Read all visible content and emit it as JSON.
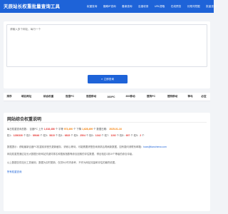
{
  "header": {
    "brand": "天辰站长权重批量查询工具",
    "nav": [
      "权重查询",
      "蜘蛛IP查询",
      "备案查询",
      "百度收录",
      "URL提取",
      "在线预览",
      "长尾词挖掘",
      "批量查询"
    ]
  },
  "search": {
    "placeholder": "请输入多个网址，每行一个",
    "button_label": "立即查询",
    "button_icon": "search-icon"
  },
  "table": {
    "headers": [
      "排序",
      "域名网址",
      "综合权重",
      "百度PC",
      "百度移动",
      "360PC",
      "360移动",
      "搜狗PC",
      "搜狗移动",
      "神马",
      "必应"
    ]
  },
  "info": {
    "title": "网站综合权重说明",
    "line1": {
      "label": "每日权重查询总数：",
      "baidu_pc_label": "百度PC 上升",
      "baidu_pc_value": "1,618,486",
      "unit": "个",
      "pc_label": "平等",
      "pc_value": "973,490",
      "down_label": "下降",
      "down_value": "1,628,499",
      "update_label": "数据日期：",
      "update_value": "2025-01-16"
    },
    "line2": {
      "items": [
        {
          "label": "权1：",
          "value": "1280330"
        },
        {
          "label": "权2：",
          "value": "89046"
        },
        {
          "label": "权3：",
          "value": "5815"
        },
        {
          "label": "权4：",
          "value": "6815"
        },
        {
          "label": "权5：",
          "value": "2504"
        },
        {
          "label": "权6：",
          "value": "1342"
        },
        {
          "label": "权7：",
          "value": "1192"
        },
        {
          "label": "权8：",
          "value": "697"
        },
        {
          "label": "权9：",
          "value": "2"
        }
      ],
      "unit": "个"
    },
    "line3": "数据提示：获取最新百度PC权重前请首先更新缓存，请耐心等待，可能需要清楚查询请求后再刷新数据，如有疑问请联系邮箱：",
    "email": "tcws@tianchenw.com",
    "line4": "网站权重是通过站长大数据分析网站关键词排名和搜索指数等综合因素的评估数据，得出相应1到10个等级的综合评级。",
    "line5": "以上数据仅供站长工具使用，数据为实时更新，仅供5小时内参考，不作为网站流量和评估的最终依据。",
    "link": "所有权重查询"
  }
}
